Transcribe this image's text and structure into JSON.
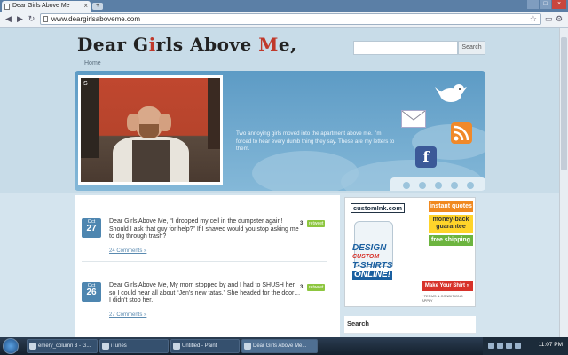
{
  "browser": {
    "tab_title": "Dear Girls Above Me",
    "new_tab": "+",
    "url": "www.deargirlsaboveme.com",
    "window_buttons": [
      "–",
      "□",
      "×"
    ]
  },
  "site": {
    "logo_part1": "Dear G",
    "logo_i": "i",
    "logo_part2": "rls Above ",
    "logo_m": "M",
    "logo_part3": "e,",
    "home_link": "Home",
    "search_button": "Search",
    "search_placeholder": "",
    "banner_text": "Two annoying girls moved into the apartment above me. I'm forced to hear every dumb thing they say. These are my letters to them.",
    "photo_corner": "S"
  },
  "posts": [
    {
      "month": "Oct",
      "day": "27",
      "text": "Dear Girls Above Me, “I dropped my cell in the dumpster again! Should I ask that guy for help?” If I shaved would you stop asking me to dig through trash?",
      "retweet_count": "3",
      "retweet_label": "retweet",
      "comments": "24 Comments »"
    },
    {
      "month": "Oct",
      "day": "26",
      "text": "Dear Girls Above Me, My mom stopped by and I had to SHUSH her so I could hear all about “Jen's new tatas.” She headed for the door… I didn't stop her.",
      "retweet_count": "3",
      "retweet_label": "retweet",
      "comments": "27 Comments »"
    }
  ],
  "ad": {
    "logo": "customInk.com",
    "design": "DESIGN",
    "custom": "CUSTOM",
    "tshirts": "T-SHIRTS",
    "online": "ONLINE!",
    "instant": "instant quotes",
    "moneyback": "money-back guarantee",
    "free": "free shipping",
    "make": "Make Your Shirt »",
    "terms": "* TERMS & CONDITIONS APPLY"
  },
  "sidebar": {
    "search_heading": "Search"
  },
  "taskbar": {
    "tasks": [
      "emery_column 3 - G...",
      "iTunes",
      "Untitled - Paint",
      "Dear Girls Above Me..."
    ],
    "clock": "11:07 PM"
  },
  "colors": {
    "banner": "#5d9bc5",
    "date_badge": "#4e86b0",
    "retweet": "#8dc63f",
    "logo_red": "#c0392b"
  }
}
